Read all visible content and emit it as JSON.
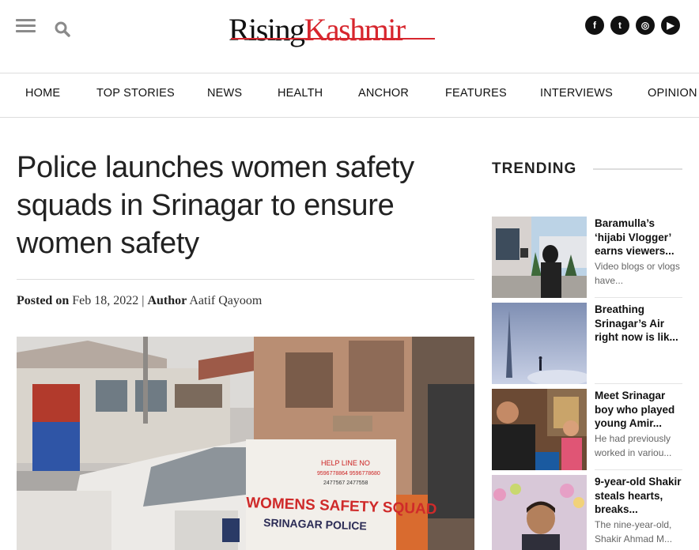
{
  "header": {
    "logo_left": "Rising",
    "logo_right": "Kashmir",
    "social": [
      {
        "icon": "facebook-icon",
        "glyph": "f"
      },
      {
        "icon": "twitter-icon",
        "glyph": "t"
      },
      {
        "icon": "instagram-icon",
        "glyph": "◎"
      },
      {
        "icon": "youtube-icon",
        "glyph": "▶"
      }
    ]
  },
  "nav": [
    "HOME",
    "TOP STORIES",
    "NEWS",
    "HEALTH",
    "ANCHOR",
    "FEATURES",
    "INTERVIEWS",
    "OPINION"
  ],
  "article": {
    "headline": "Police launches women safety squads in Srinagar to ensure women safety",
    "posted_label": "Posted on",
    "date": "Feb 18, 2022",
    "separator": "|",
    "author_label": "Author",
    "author": "Aatif Qayoom",
    "hero": {
      "sign_line1": "HELP LINE NO",
      "sign_line2": "9596778864 9596778680",
      "sign_line3": "2477567 2477558",
      "sign_main": "WOMENS SAFETY SQUAD",
      "sign_sub": "SRINAGAR POLICE"
    }
  },
  "trending": {
    "title": "TRENDING",
    "items": [
      {
        "title": "Baramulla’s ‘hijabi Vlogger’ earns viewers...",
        "desc": "Video blogs or vlogs have..."
      },
      {
        "title": "Breathing Srinagar’s Air right now is lik...",
        "desc": ""
      },
      {
        "title": "Meet Srinagar boy who played young Amir...",
        "desc": "He had previously worked in variou..."
      },
      {
        "title": "9-year-old Shakir steals hearts, breaks...",
        "desc": "The nine-year-old, Shakir Ahmad M..."
      }
    ]
  },
  "colors": {
    "brand_red": "#d7262e",
    "text": "#222222",
    "muted": "#666666"
  }
}
